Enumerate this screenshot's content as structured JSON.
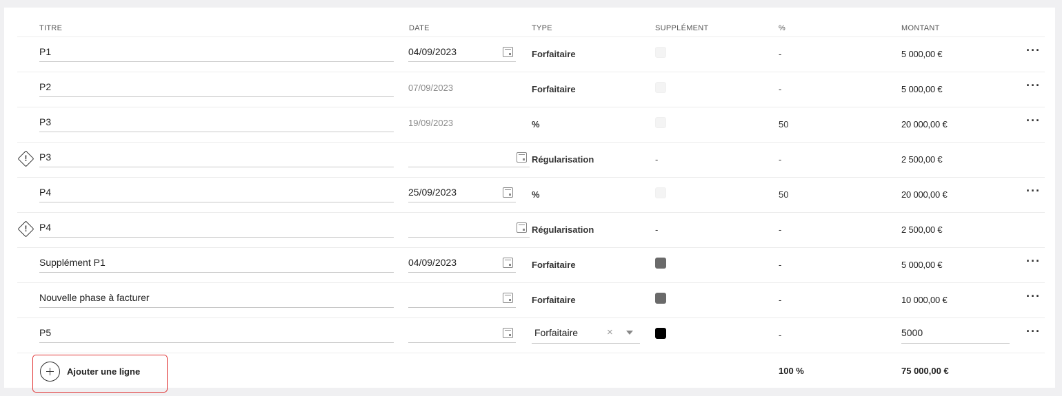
{
  "headers": {
    "titre": "TITRE",
    "date": "DATE",
    "type": "TYPE",
    "supplement": "SUPPLÉMENT",
    "pct": "%",
    "montant": "MONTANT"
  },
  "rows": [
    {
      "titre": "P1",
      "date": "04/09/2023",
      "type": "Forfaitaire",
      "pct": "-",
      "montant": "5 000,00 €"
    },
    {
      "titre": "P2",
      "date": "07/09/2023",
      "type": "Forfaitaire",
      "pct": "-",
      "montant": "5 000,00 €"
    },
    {
      "titre": "P3",
      "date": "19/09/2023",
      "type": "%",
      "pct": "50",
      "montant": "20 000,00 €"
    },
    {
      "titre": "P3",
      "date": "",
      "type": "Régularisation",
      "supplement": "-",
      "pct": "-",
      "montant": "2 500,00 €"
    },
    {
      "titre": "P4",
      "date": "25/09/2023",
      "type": "%",
      "pct": "50",
      "montant": "20 000,00 €"
    },
    {
      "titre": "P4",
      "date": "",
      "type": "Régularisation",
      "supplement": "-",
      "pct": "-",
      "montant": "2 500,00 €"
    },
    {
      "titre": "Supplément P1",
      "date": "04/09/2023",
      "type": "Forfaitaire",
      "pct": "-",
      "montant": "5 000,00 €"
    },
    {
      "titre": "Nouvelle phase à facturer",
      "date": "",
      "type": "Forfaitaire",
      "pct": "-",
      "montant": "10 000,00 €"
    },
    {
      "titre": "P5",
      "date": "",
      "type": "Forfaitaire",
      "pct": "-",
      "montant": "5000"
    }
  ],
  "warning_mark": "!",
  "row_menu": "···",
  "clear_mark": "×",
  "add_line_label": "Ajouter une ligne",
  "totals": {
    "pct": "100 %",
    "montant": "75 000,00 €"
  },
  "colors": {
    "supplement_checked": "#6a6a6a",
    "supplement_active": "#000000",
    "highlight": "#e03333"
  }
}
